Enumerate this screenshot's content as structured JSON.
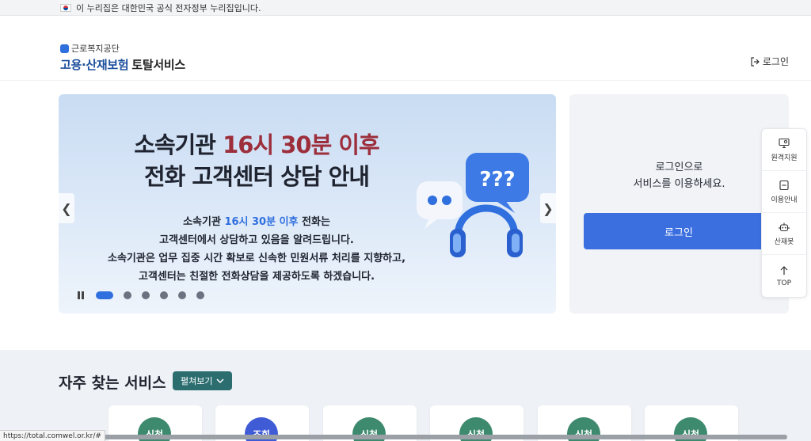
{
  "gov_bar": {
    "text": "이 누리집은 대한민국 공식 전자정부 누리집입니다."
  },
  "header": {
    "org_name": "근로복지공단",
    "service_name_main": "고용·산재보험",
    "service_name_suffix": "토탈서비스",
    "login_label": "로그인"
  },
  "banner": {
    "title_line1_pre": "소속기관 ",
    "title_line1_accent": "16시 30분 이후",
    "title_line2": "전화 고객센터 상담 안내",
    "desc_line1_pre": "소속기관 ",
    "desc_line1_accent": "16시 30분 이후",
    "desc_line1_post": " 전화는",
    "desc_line2": "고객센터에서 상담하고 있음을 알려드립니다.",
    "desc_line3": "소속기관은 업무 집중 시간 확보로 신속한 민원서류 처리를 지향하고,",
    "desc_line4": "고객센터는 친절한 전화상담을 제공하도록 하겠습니다.",
    "illustration_text": "???",
    "slide_count": 6,
    "active_slide": 1
  },
  "login_panel": {
    "message_line1": "로그인으로",
    "message_line2": "서비스를 이용하세요.",
    "button_label": "로그인"
  },
  "quick_menu": [
    {
      "label": "원격지원",
      "icon": "remote-support-icon"
    },
    {
      "label": "이용안내",
      "icon": "guide-icon"
    },
    {
      "label": "산재봇",
      "icon": "robot-icon"
    },
    {
      "label": "TOP",
      "icon": "arrow-up-icon"
    }
  ],
  "frequent_services": {
    "heading": "자주 찾는 서비스",
    "expand_label": "펼쳐보기",
    "cards": [
      {
        "label": "신청",
        "color": "#3e8a6e"
      },
      {
        "label": "조회",
        "color": "#3f5bd6"
      },
      {
        "label": "신청",
        "color": "#3e8a6e"
      },
      {
        "label": "신청",
        "color": "#3e8a6e"
      },
      {
        "label": "신청",
        "color": "#3e8a6e"
      },
      {
        "label": "신청",
        "color": "#3e8a6e"
      }
    ]
  },
  "status_bar": {
    "url": "https://total.comwel.or.kr/#"
  },
  "colors": {
    "primary": "#3b6fe0",
    "teal": "#2c6e70",
    "banner_accent": "#9c2f3b"
  }
}
